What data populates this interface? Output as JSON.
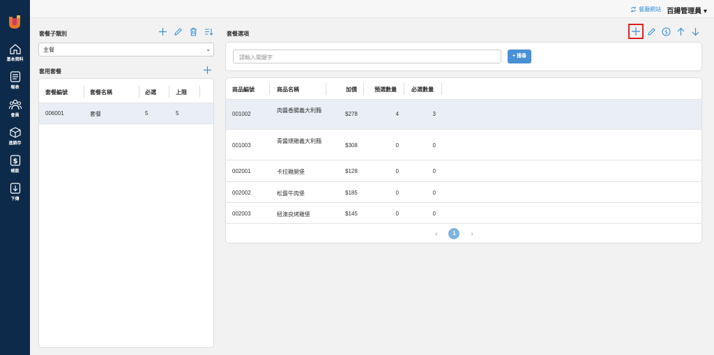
{
  "sidebar": {
    "items": [
      {
        "label": "基本資料",
        "icon": "home-icon"
      },
      {
        "label": "報表",
        "icon": "report-icon"
      },
      {
        "label": "會員",
        "icon": "members-icon"
      },
      {
        "label": "進銷存",
        "icon": "box-icon"
      },
      {
        "label": "帳款",
        "icon": "dollar-icon"
      },
      {
        "label": "下傳",
        "icon": "download-icon"
      }
    ]
  },
  "topbar": {
    "ext_link": "餐廳網站",
    "user": "百揚管理員 ▾"
  },
  "left": {
    "subcategory_title": "套餐子類別",
    "subcategory_value": "主餐",
    "combo_title": "套用套餐",
    "headers": [
      "套餐編號",
      "套餐名稱",
      "必選",
      "上限"
    ],
    "rows": [
      {
        "code": "006001",
        "name": "套餐",
        "required": "5",
        "limit": "5"
      }
    ]
  },
  "right": {
    "title": "套餐選項",
    "search_placeholder": "請輸入關鍵字",
    "search_button": "+ 搜尋",
    "headers": [
      "商品編號",
      "商品名稱",
      "加價",
      "預選數量",
      "必選數量"
    ],
    "rows": [
      {
        "code": "001002",
        "name": "肉醬香腸義大利麵",
        "price": "$278",
        "preset": "4",
        "required": "3"
      },
      {
        "code": "001003",
        "name": "青醬燻雞義大利麵",
        "price": "$308",
        "preset": "0",
        "required": "0"
      },
      {
        "code": "002001",
        "name": "卡拉雞腿堡",
        "price": "$128",
        "preset": "0",
        "required": "0"
      },
      {
        "code": "002002",
        "name": "松露牛肉堡",
        "price": "$185",
        "preset": "0",
        "required": "0"
      },
      {
        "code": "002003",
        "name": "紐澳良烤雞堡",
        "price": "$145",
        "preset": "0",
        "required": "0"
      }
    ],
    "page": "1"
  },
  "colors": {
    "sidebar": "#0e2a4a",
    "accent": "#3a8fd6",
    "selected_row": "#e9eff5"
  }
}
